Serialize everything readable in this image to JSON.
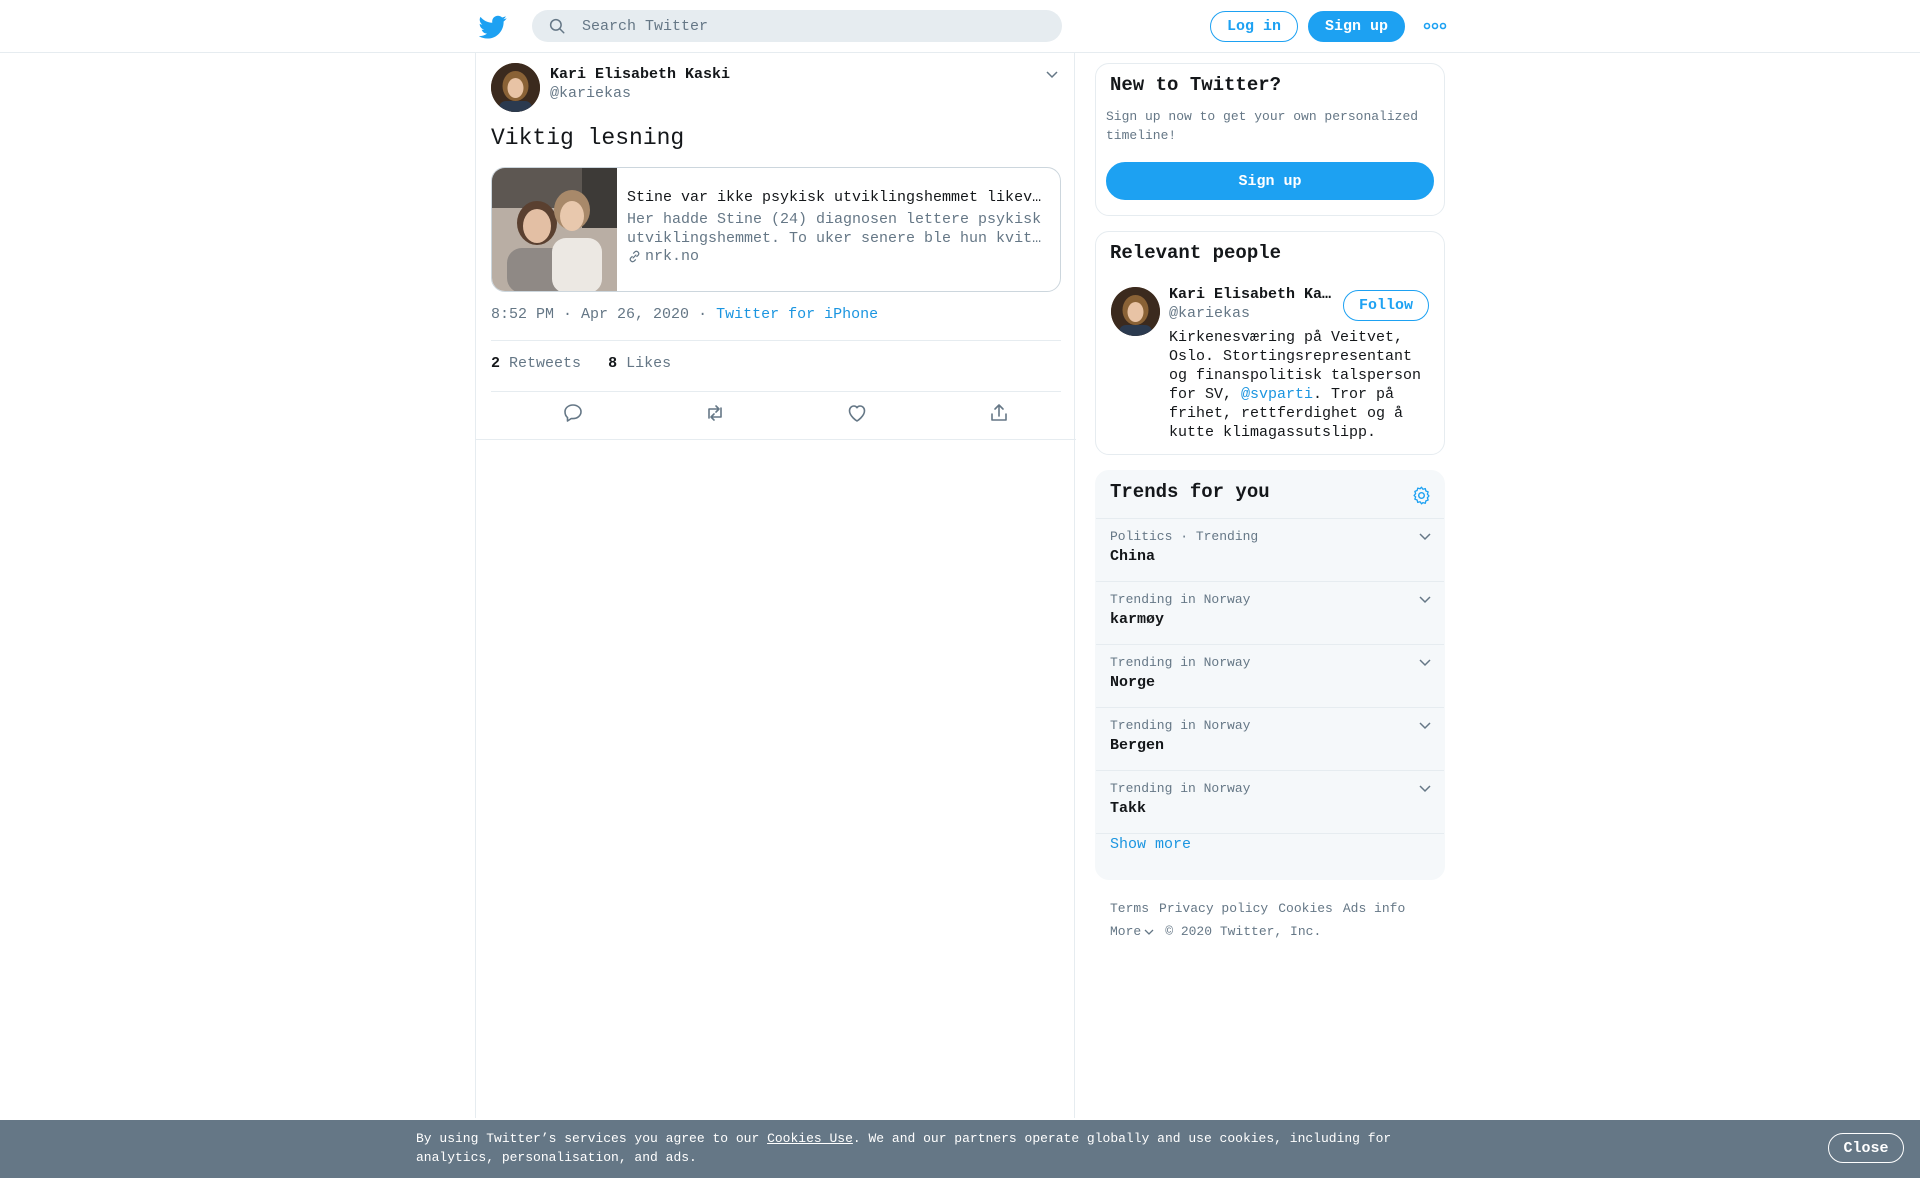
{
  "header": {
    "logo_icon": "twitter-bird-icon",
    "search_placeholder": "Search Twitter",
    "login_label": "Log in",
    "signup_label": "Sign up",
    "more_icon": "more-dots-icon"
  },
  "tweet": {
    "author_name": "Kari Elisabeth Kaski",
    "author_handle": "@kariekas",
    "text": "Viktig lesning",
    "card": {
      "title": "Stine var ikke psykisk utviklingshemmet likevel",
      "description_line1": "Her hadde Stine (24) diagnosen lettere psykisk",
      "description_line2": "utviklingshemmet. To uker senere ble hun kvitt diagnosen.",
      "domain": "nrk.no"
    },
    "time": "8:52 PM · Apr 26, 2020",
    "separator": "·",
    "source": "Twitter for iPhone",
    "retweets_count": "2",
    "retweets_label": "Retweets",
    "likes_count": "8",
    "likes_label": "Likes"
  },
  "sidebar": {
    "new_to_twitter": {
      "title": "New to Twitter?",
      "subtitle": "Sign up now to get your own personalized timeline!",
      "signup_label": "Sign up"
    },
    "relevant_people": {
      "title": "Relevant people",
      "name": "Kari Elisabeth Kaski",
      "handle": "@kariekas",
      "follow_label": "Follow",
      "bio_before": "Kirkenesværing på Veitvet, Oslo. Stortingsrepresentant og finanspolitisk talsperson for SV, ",
      "bio_mention": "@svparti",
      "bio_after": ". Tror på frihet, rettferdighet og å kutte klimagassutslipp."
    },
    "trends": {
      "title": "Trends for you",
      "items": [
        {
          "context": "Politics · Trending",
          "name": "China"
        },
        {
          "context": "Trending in Norway",
          "name": "karmøy"
        },
        {
          "context": "Trending in Norway",
          "name": "Norge"
        },
        {
          "context": "Trending in Norway",
          "name": "Bergen"
        },
        {
          "context": "Trending in Norway",
          "name": "Takk"
        }
      ],
      "show_more": "Show more"
    },
    "footer": {
      "terms": "Terms",
      "privacy": "Privacy policy",
      "cookies": "Cookies",
      "ads": "Ads info",
      "more": "More",
      "copyright": "© 2020 Twitter, Inc."
    }
  },
  "cookie_bar": {
    "text_before": "By using Twitter’s services you agree to our ",
    "link": "Cookies Use",
    "text_after": ". We and our partners operate globally and use cookies, including for analytics, personalisation, and ads.",
    "close_label": "Close"
  },
  "colors": {
    "accent": "#1da1f2",
    "link": "#1b95e0",
    "secondary_text": "#657786",
    "border": "#e6ecf0",
    "cookie_bar_bg": "#657786"
  }
}
